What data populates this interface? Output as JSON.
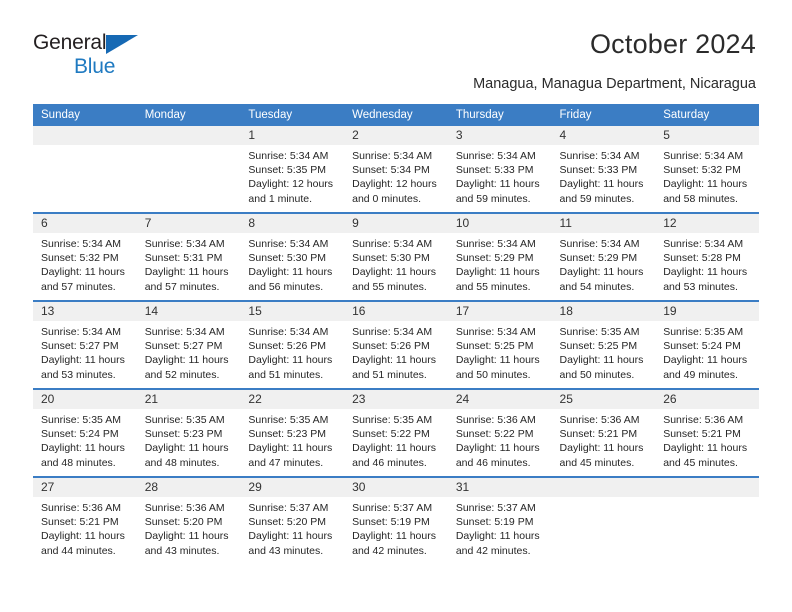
{
  "logo": {
    "word1": "General",
    "word2": "Blue",
    "triangle_color": "#1669b4",
    "word2_color": "#1f7ac1"
  },
  "header": {
    "title": "October 2024",
    "subtitle": "Managua, Managua Department, Nicaragua"
  },
  "calendar": {
    "header_bg": "#3b7dc4",
    "daynum_bg": "#f0f0f0",
    "weekday_headers": [
      "Sunday",
      "Monday",
      "Tuesday",
      "Wednesday",
      "Thursday",
      "Friday",
      "Saturday"
    ],
    "weeks": [
      [
        {
          "day": "",
          "sunrise": "",
          "sunset": "",
          "daylight_line1": "",
          "daylight_line2": ""
        },
        {
          "day": "",
          "sunrise": "",
          "sunset": "",
          "daylight_line1": "",
          "daylight_line2": ""
        },
        {
          "day": "1",
          "sunrise": "Sunrise: 5:34 AM",
          "sunset": "Sunset: 5:35 PM",
          "daylight_line1": "Daylight: 12 hours",
          "daylight_line2": "and 1 minute."
        },
        {
          "day": "2",
          "sunrise": "Sunrise: 5:34 AM",
          "sunset": "Sunset: 5:34 PM",
          "daylight_line1": "Daylight: 12 hours",
          "daylight_line2": "and 0 minutes."
        },
        {
          "day": "3",
          "sunrise": "Sunrise: 5:34 AM",
          "sunset": "Sunset: 5:33 PM",
          "daylight_line1": "Daylight: 11 hours",
          "daylight_line2": "and 59 minutes."
        },
        {
          "day": "4",
          "sunrise": "Sunrise: 5:34 AM",
          "sunset": "Sunset: 5:33 PM",
          "daylight_line1": "Daylight: 11 hours",
          "daylight_line2": "and 59 minutes."
        },
        {
          "day": "5",
          "sunrise": "Sunrise: 5:34 AM",
          "sunset": "Sunset: 5:32 PM",
          "daylight_line1": "Daylight: 11 hours",
          "daylight_line2": "and 58 minutes."
        }
      ],
      [
        {
          "day": "6",
          "sunrise": "Sunrise: 5:34 AM",
          "sunset": "Sunset: 5:32 PM",
          "daylight_line1": "Daylight: 11 hours",
          "daylight_line2": "and 57 minutes."
        },
        {
          "day": "7",
          "sunrise": "Sunrise: 5:34 AM",
          "sunset": "Sunset: 5:31 PM",
          "daylight_line1": "Daylight: 11 hours",
          "daylight_line2": "and 57 minutes."
        },
        {
          "day": "8",
          "sunrise": "Sunrise: 5:34 AM",
          "sunset": "Sunset: 5:30 PM",
          "daylight_line1": "Daylight: 11 hours",
          "daylight_line2": "and 56 minutes."
        },
        {
          "day": "9",
          "sunrise": "Sunrise: 5:34 AM",
          "sunset": "Sunset: 5:30 PM",
          "daylight_line1": "Daylight: 11 hours",
          "daylight_line2": "and 55 minutes."
        },
        {
          "day": "10",
          "sunrise": "Sunrise: 5:34 AM",
          "sunset": "Sunset: 5:29 PM",
          "daylight_line1": "Daylight: 11 hours",
          "daylight_line2": "and 55 minutes."
        },
        {
          "day": "11",
          "sunrise": "Sunrise: 5:34 AM",
          "sunset": "Sunset: 5:29 PM",
          "daylight_line1": "Daylight: 11 hours",
          "daylight_line2": "and 54 minutes."
        },
        {
          "day": "12",
          "sunrise": "Sunrise: 5:34 AM",
          "sunset": "Sunset: 5:28 PM",
          "daylight_line1": "Daylight: 11 hours",
          "daylight_line2": "and 53 minutes."
        }
      ],
      [
        {
          "day": "13",
          "sunrise": "Sunrise: 5:34 AM",
          "sunset": "Sunset: 5:27 PM",
          "daylight_line1": "Daylight: 11 hours",
          "daylight_line2": "and 53 minutes."
        },
        {
          "day": "14",
          "sunrise": "Sunrise: 5:34 AM",
          "sunset": "Sunset: 5:27 PM",
          "daylight_line1": "Daylight: 11 hours",
          "daylight_line2": "and 52 minutes."
        },
        {
          "day": "15",
          "sunrise": "Sunrise: 5:34 AM",
          "sunset": "Sunset: 5:26 PM",
          "daylight_line1": "Daylight: 11 hours",
          "daylight_line2": "and 51 minutes."
        },
        {
          "day": "16",
          "sunrise": "Sunrise: 5:34 AM",
          "sunset": "Sunset: 5:26 PM",
          "daylight_line1": "Daylight: 11 hours",
          "daylight_line2": "and 51 minutes."
        },
        {
          "day": "17",
          "sunrise": "Sunrise: 5:34 AM",
          "sunset": "Sunset: 5:25 PM",
          "daylight_line1": "Daylight: 11 hours",
          "daylight_line2": "and 50 minutes."
        },
        {
          "day": "18",
          "sunrise": "Sunrise: 5:35 AM",
          "sunset": "Sunset: 5:25 PM",
          "daylight_line1": "Daylight: 11 hours",
          "daylight_line2": "and 50 minutes."
        },
        {
          "day": "19",
          "sunrise": "Sunrise: 5:35 AM",
          "sunset": "Sunset: 5:24 PM",
          "daylight_line1": "Daylight: 11 hours",
          "daylight_line2": "and 49 minutes."
        }
      ],
      [
        {
          "day": "20",
          "sunrise": "Sunrise: 5:35 AM",
          "sunset": "Sunset: 5:24 PM",
          "daylight_line1": "Daylight: 11 hours",
          "daylight_line2": "and 48 minutes."
        },
        {
          "day": "21",
          "sunrise": "Sunrise: 5:35 AM",
          "sunset": "Sunset: 5:23 PM",
          "daylight_line1": "Daylight: 11 hours",
          "daylight_line2": "and 48 minutes."
        },
        {
          "day": "22",
          "sunrise": "Sunrise: 5:35 AM",
          "sunset": "Sunset: 5:23 PM",
          "daylight_line1": "Daylight: 11 hours",
          "daylight_line2": "and 47 minutes."
        },
        {
          "day": "23",
          "sunrise": "Sunrise: 5:35 AM",
          "sunset": "Sunset: 5:22 PM",
          "daylight_line1": "Daylight: 11 hours",
          "daylight_line2": "and 46 minutes."
        },
        {
          "day": "24",
          "sunrise": "Sunrise: 5:36 AM",
          "sunset": "Sunset: 5:22 PM",
          "daylight_line1": "Daylight: 11 hours",
          "daylight_line2": "and 46 minutes."
        },
        {
          "day": "25",
          "sunrise": "Sunrise: 5:36 AM",
          "sunset": "Sunset: 5:21 PM",
          "daylight_line1": "Daylight: 11 hours",
          "daylight_line2": "and 45 minutes."
        },
        {
          "day": "26",
          "sunrise": "Sunrise: 5:36 AM",
          "sunset": "Sunset: 5:21 PM",
          "daylight_line1": "Daylight: 11 hours",
          "daylight_line2": "and 45 minutes."
        }
      ],
      [
        {
          "day": "27",
          "sunrise": "Sunrise: 5:36 AM",
          "sunset": "Sunset: 5:21 PM",
          "daylight_line1": "Daylight: 11 hours",
          "daylight_line2": "and 44 minutes."
        },
        {
          "day": "28",
          "sunrise": "Sunrise: 5:36 AM",
          "sunset": "Sunset: 5:20 PM",
          "daylight_line1": "Daylight: 11 hours",
          "daylight_line2": "and 43 minutes."
        },
        {
          "day": "29",
          "sunrise": "Sunrise: 5:37 AM",
          "sunset": "Sunset: 5:20 PM",
          "daylight_line1": "Daylight: 11 hours",
          "daylight_line2": "and 43 minutes."
        },
        {
          "day": "30",
          "sunrise": "Sunrise: 5:37 AM",
          "sunset": "Sunset: 5:19 PM",
          "daylight_line1": "Daylight: 11 hours",
          "daylight_line2": "and 42 minutes."
        },
        {
          "day": "31",
          "sunrise": "Sunrise: 5:37 AM",
          "sunset": "Sunset: 5:19 PM",
          "daylight_line1": "Daylight: 11 hours",
          "daylight_line2": "and 42 minutes."
        },
        {
          "day": "",
          "sunrise": "",
          "sunset": "",
          "daylight_line1": "",
          "daylight_line2": ""
        },
        {
          "day": "",
          "sunrise": "",
          "sunset": "",
          "daylight_line1": "",
          "daylight_line2": ""
        }
      ]
    ]
  }
}
